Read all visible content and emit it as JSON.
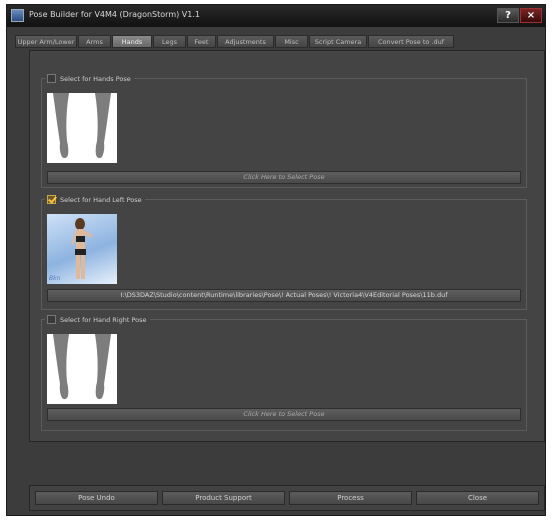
{
  "window": {
    "title": "Pose Builder for V4M4 (DragonStorm) V1.1",
    "help_label": "?",
    "close_label": "×"
  },
  "tabs": [
    {
      "label": "Upper Arm/Lower"
    },
    {
      "label": "Arms"
    },
    {
      "label": "Hands",
      "active": true
    },
    {
      "label": "Legs"
    },
    {
      "label": "Feet"
    },
    {
      "label": "Adjustments"
    },
    {
      "label": "Misc"
    },
    {
      "label": "Script Camera"
    },
    {
      "label": "Convert Pose to .duf"
    }
  ],
  "groups": {
    "hands": {
      "label": "Select for Hands Pose",
      "checked": false,
      "button": "Click Here to Select Pose"
    },
    "left": {
      "label": "Select for Hand Left Pose",
      "checked": true,
      "thumb_caption": "Bkn",
      "button": "I:\\DS3DAZ\\Studio\\content\\Runtime\\libraries\\Pose\\! Actual Poses\\! Victoria4\\V4Editorial Poses\\11b.duf"
    },
    "right": {
      "label": "Select for Hand Right Pose",
      "checked": false,
      "button": "Click Here to Select Pose"
    }
  },
  "footer": {
    "undo": "Pose Undo",
    "support": "Product Support",
    "process": "Process",
    "close": "Close"
  },
  "colors": {
    "window_bg": "#3c3c3c",
    "panel_bg": "#444444",
    "check_accent": "#ffc53a"
  }
}
